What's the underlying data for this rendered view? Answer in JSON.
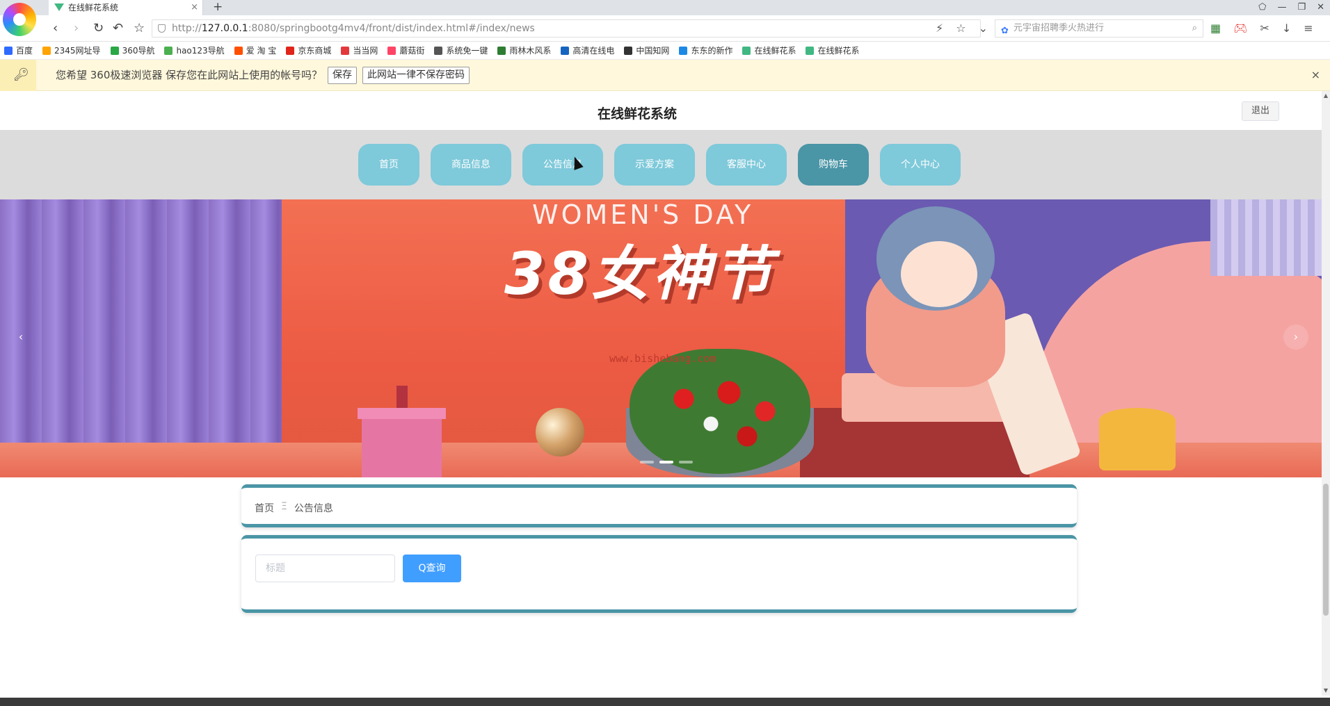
{
  "browser": {
    "tab_title": "在线鲜花系统",
    "tab_close": "×",
    "new_tab": "+",
    "url_prefix": "http://",
    "url_host": "127.0.0.1",
    "url_rest": ":8080/springbootg4mv4/front/dist/index.html#/index/news",
    "search_placeholder": "元宇宙招聘季火热进行",
    "bookmarks": [
      {
        "label": "百度",
        "color": "#2f6bff"
      },
      {
        "label": "2345网址导",
        "color": "#ffa400"
      },
      {
        "label": "360导航",
        "color": "#2aa845"
      },
      {
        "label": "hao123导航",
        "color": "#4caf50"
      },
      {
        "label": "爱 淘 宝",
        "color": "#ff5000"
      },
      {
        "label": "京东商城",
        "color": "#e1251b"
      },
      {
        "label": "当当网",
        "color": "#e4393c"
      },
      {
        "label": "蘑菇街",
        "color": "#ff4466"
      },
      {
        "label": "系统免一键",
        "color": "#555555"
      },
      {
        "label": "雨林木风系",
        "color": "#2e7d32"
      },
      {
        "label": "高清在线电",
        "color": "#1565c0"
      },
      {
        "label": "中国知网",
        "color": "#333333"
      },
      {
        "label": "东东的新作",
        "color": "#1e88e5"
      },
      {
        "label": "在线鲜花系",
        "color": "#41b883"
      },
      {
        "label": "在线鲜花系",
        "color": "#41b883"
      }
    ],
    "password_prompt": "您希望 360极速浏览器 保存您在此网站上使用的帐号吗？",
    "save_btn": "保存",
    "never_btn": "此网站一律不保存密码",
    "close_icon": "×"
  },
  "header": {
    "title": "在线鲜花系统",
    "logout": "退出"
  },
  "nav": {
    "items": [
      {
        "label": "首页"
      },
      {
        "label": "商品信息"
      },
      {
        "label": "公告信息"
      },
      {
        "label": "示爱方案"
      },
      {
        "label": "客服中心"
      },
      {
        "label": "购物车"
      },
      {
        "label": "个人中心"
      }
    ],
    "active_index": 5
  },
  "banner": {
    "subtitle": "WOMEN'S DAY",
    "title": "38女神节",
    "watermark": "www.bishebang.com",
    "prev": "‹",
    "next": "›"
  },
  "breadcrumb": {
    "home": "首页",
    "separator": "Ξ",
    "current": "公告信息"
  },
  "search": {
    "placeholder": "标题",
    "button": "Q查询"
  },
  "colors": {
    "nav_bg": "#7ec9da",
    "nav_active": "#4a95a6",
    "card_border": "#4a95a6",
    "primary_button": "#409eff"
  }
}
